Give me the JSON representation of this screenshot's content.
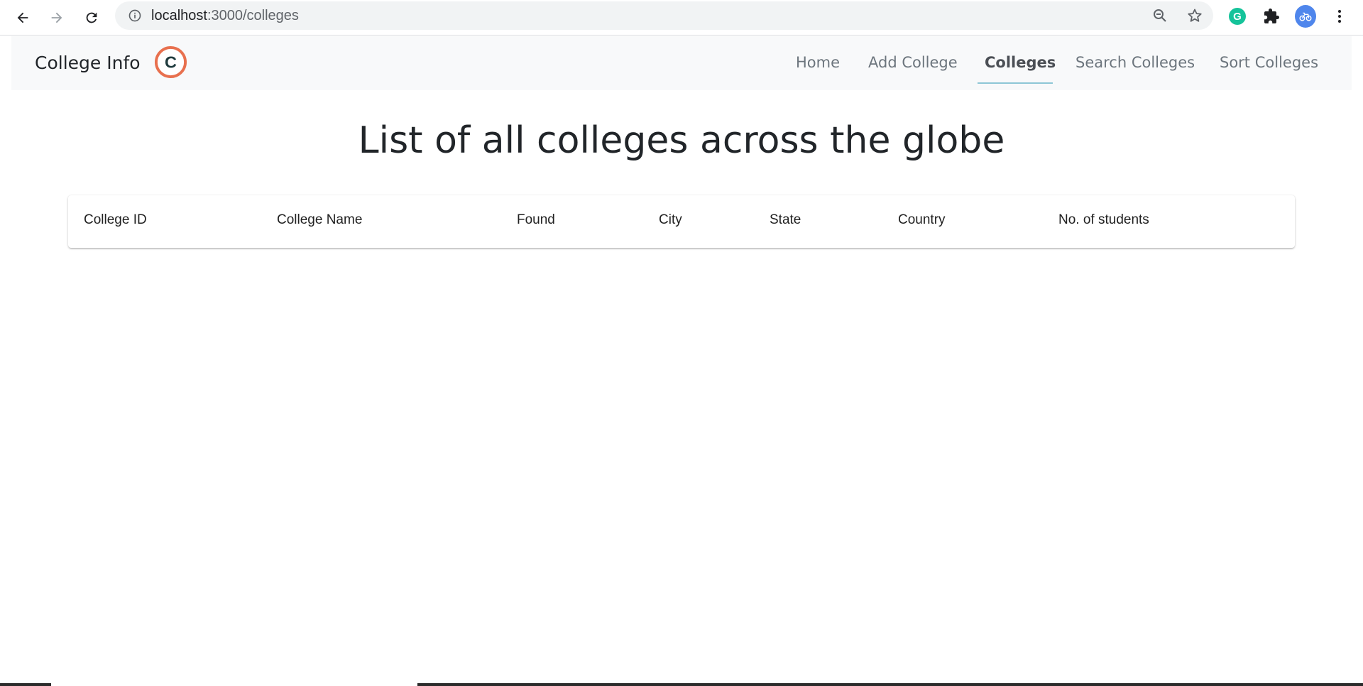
{
  "browser": {
    "url_host": "localhost",
    "url_path": ":3000/colleges",
    "extension_grammarly_letter": "G",
    "icons": [
      "back-arrow-icon",
      "forward-arrow-icon",
      "reload-icon",
      "info-icon",
      "zoom-icon",
      "star-icon",
      "grammarly-icon",
      "puzzle-icon",
      "avatar-icon",
      "kebab-menu-icon"
    ]
  },
  "navbar": {
    "brand": "College Info",
    "logo_letter": "C",
    "links": [
      {
        "label": "Home",
        "active": false
      },
      {
        "label": "Add College",
        "active": false
      },
      {
        "label": "Colleges",
        "active": true
      },
      {
        "label": "Search Colleges",
        "active": false
      },
      {
        "label": "Sort Colleges",
        "active": false
      }
    ]
  },
  "page": {
    "title": "List of all colleges across the globe"
  },
  "table": {
    "headers": [
      "College ID",
      "College Name",
      "Found",
      "City",
      "State",
      "Country",
      "No. of students"
    ],
    "rows": []
  },
  "colors": {
    "navbar_bg": "#f8f9fa",
    "logo_ring": "#e8704e",
    "logo_letter": "#1f3b3e",
    "active_underline": "#8ec6d6",
    "grammarly": "#15c39a",
    "avatar": "#4f86ec"
  }
}
